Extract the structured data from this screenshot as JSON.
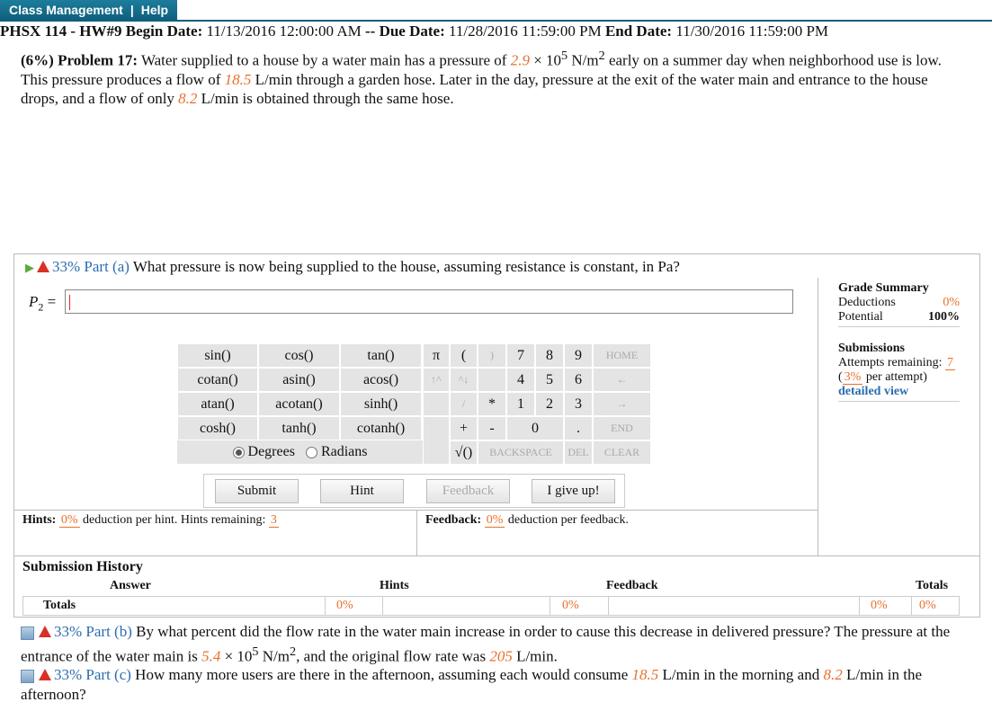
{
  "topbar": {
    "class_management": "Class Management",
    "sep": "|",
    "help": "Help"
  },
  "header": {
    "course": "PHSX 114 - HW#9",
    "begin_label": "Begin Date:",
    "begin": "11/13/2016 12:00:00 AM",
    "dash": "--",
    "due_label": "Due Date:",
    "due": "11/28/2016 11:59:00 PM",
    "end_label": "End Date:",
    "end": "11/30/2016 11:59:00 PM"
  },
  "problem": {
    "lead": "(6%) Problem 17:",
    "t1": " Water supplied to a house by a water main has a pressure of ",
    "p1_val": "2.9",
    "t2": " × 10",
    "p1_exp": "5",
    "t3": " N/m",
    "p1_sq": "2",
    "t4": " early on a summer day when neighborhood use is low. This pressure produces a flow of ",
    "flow1": "18.5",
    "t5": " L/min through a garden hose. Later in the day, pressure at the exit of the water main and entrance to the house drops, and a flow of only ",
    "flow2": "8.2",
    "t6": " L/min is obtained through the same hose."
  },
  "part_a": {
    "pct": "33% Part (a)",
    "text": " What pressure is now being supplied to the house, assuming resistance is constant, in Pa?",
    "var": "P",
    "sub": "2",
    "eq": " =",
    "value": ""
  },
  "keypad": {
    "funcs": [
      "sin()",
      "cos()",
      "tan()",
      "cotan()",
      "asin()",
      "acos()",
      "atan()",
      "acotan()",
      "sinh()",
      "cosh()",
      "tanh()",
      "cotanh()"
    ],
    "keys": {
      "pi": "π",
      "lp": "(",
      "rp": ")",
      "k7": "7",
      "k8": "8",
      "k9": "9",
      "home": "HOME",
      "up": "↑^",
      "caret": "^↓",
      "k4": "4",
      "k5": "5",
      "k6": "6",
      "left": "←",
      "div": "/",
      "mul": "*",
      "k1": "1",
      "k2": "2",
      "k3": "3",
      "right": "→",
      "plus": "+",
      "minus": "-",
      "k0": "0",
      "dot": ".",
      "endk": "END",
      "sqrt": "√()",
      "backspace": "BACKSPACE",
      "del": "DEL",
      "clear": "CLEAR"
    },
    "degrees": "Degrees",
    "radians": "Radians"
  },
  "buttons": {
    "submit": "Submit",
    "hint": "Hint",
    "feedback": "Feedback",
    "giveup": "I give up!"
  },
  "hints": {
    "label": "Hints:",
    "pct": "0%",
    "t1": " deduction per hint. Hints remaining: ",
    "remaining": "3"
  },
  "feedback": {
    "label": "Feedback:",
    "pct": "0%",
    "t1": " deduction per feedback."
  },
  "grade": {
    "title": "Grade Summary",
    "deductions_label": "Deductions",
    "deductions": "0%",
    "potential_label": "Potential",
    "potential": "100%",
    "submissions": "Submissions",
    "attempts_label": "Attempts remaining: ",
    "attempts": "7",
    "per_attempt_pct": "3%",
    "per_attempt": " per attempt)",
    "open_paren": "(",
    "detailed": "detailed view"
  },
  "history": {
    "title": "Submission History",
    "answer": "Answer",
    "hints": "Hints",
    "feedback": "Feedback",
    "totals": "Totals",
    "row_label": "Totals",
    "c1": "0%",
    "c2": "0%",
    "c3": "0%",
    "c4": "0%"
  },
  "part_b": {
    "pct": "33% Part (b)",
    "t1": " By what percent did the flow rate in the water main increase in order to cause this decrease in delivered pressure? The pressure at the entrance of the water main is ",
    "p_val": "5.4",
    "t2": " × 10",
    "exp": "5",
    "t3": " N/m",
    "sq": "2",
    "t4": ", and the original flow rate was ",
    "flow": "205",
    "t5": " L/min."
  },
  "part_c": {
    "pct": "33% Part (c)",
    "t1": " How many more users are there in the afternoon, assuming each would consume ",
    "f1": "18.5",
    "t2": " L/min in the morning and ",
    "f2": "8.2",
    "t3": " L/min in the afternoon?"
  }
}
